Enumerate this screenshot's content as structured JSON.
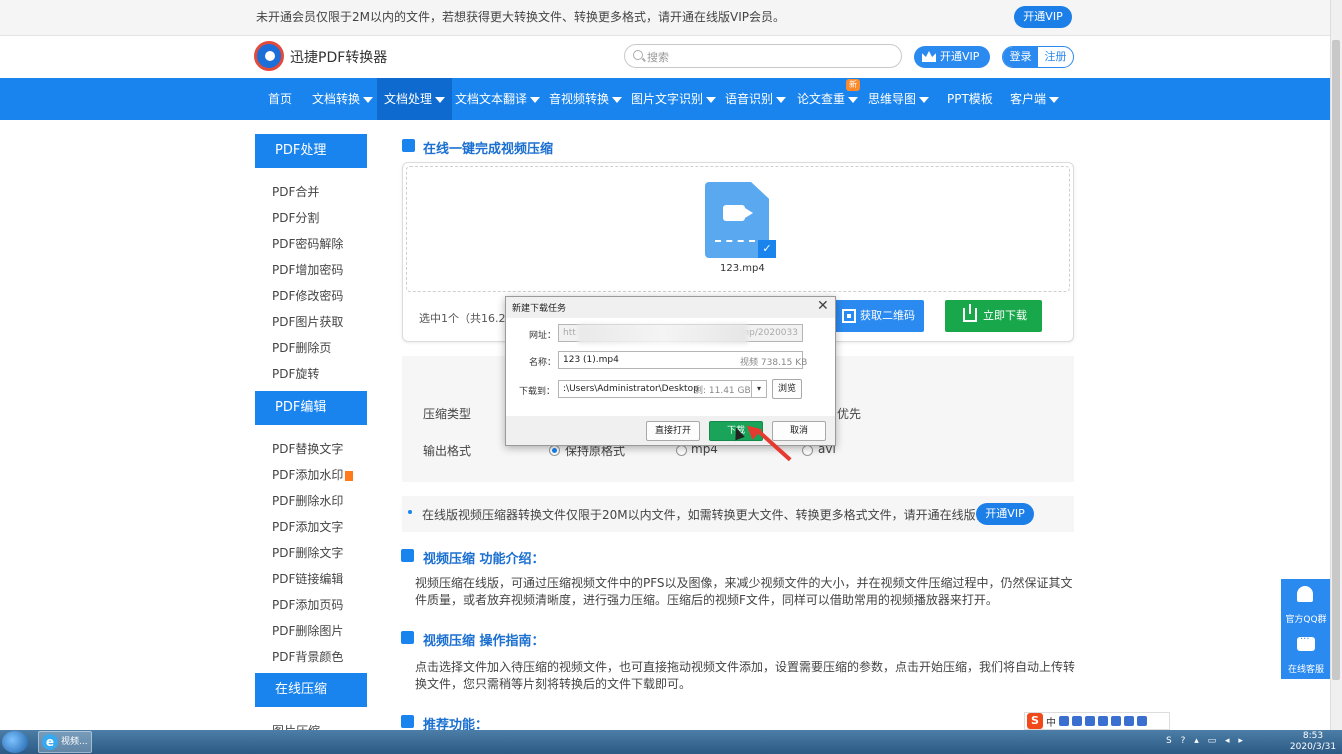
{
  "promo": {
    "text": "未开通会员仅限于2M以内的文件，若想获得更大转换文件、转换更多格式，请开通在线版VIP会员。",
    "button": "开通VIP"
  },
  "header": {
    "logo_text": "迅捷PDF转换器",
    "search_placeholder": "搜索",
    "vip_button": "开通VIP",
    "login": "登录",
    "register": "注册"
  },
  "nav": {
    "items": [
      {
        "label": "首页"
      },
      {
        "label": "文档转换"
      },
      {
        "label": "文档处理"
      },
      {
        "label": "文档文本翻译"
      },
      {
        "label": "音视频转换"
      },
      {
        "label": "图片文字识别"
      },
      {
        "label": "语音识别"
      },
      {
        "label": "论文查重"
      },
      {
        "label": "思维导图"
      },
      {
        "label": "PPT模板"
      },
      {
        "label": "客户端"
      }
    ],
    "new_badge": "新"
  },
  "sidebar": {
    "sections": [
      {
        "title": "PDF处理",
        "items": [
          "PDF合并",
          "PDF分割",
          "PDF密码解除",
          "PDF增加密码",
          "PDF修改密码",
          "PDF图片获取",
          "PDF删除页",
          "PDF旋转"
        ]
      },
      {
        "title": "PDF编辑",
        "items": [
          "PDF替换文字",
          "PDF添加水印",
          "PDF删除水印",
          "PDF添加文字",
          "PDF删除文字",
          "PDF链接编辑",
          "PDF添加页码",
          "PDF删除图片",
          "PDF背景颜色"
        ]
      },
      {
        "title": "在线压缩",
        "items": [
          "图片压缩"
        ]
      }
    ]
  },
  "main": {
    "title": "在线一键完成视频压缩",
    "file_name": "123.mp4",
    "selected": "选中1个（共16.22M",
    "qr_button": "获取二维码",
    "download_button": "立即下载",
    "compress_type_label": "压缩类型",
    "compress_option_right": "优先",
    "output_format_label": "输出格式",
    "formats": [
      "保持原格式",
      "mp4",
      "avi"
    ],
    "notice": "在线版视频压缩器转换文件仅限于20M以内文件，如需转换更大文件、转换更多格式文件，请开通在线版会员。",
    "notice_button": "开通VIP",
    "intro_title": "视频压缩 功能介绍：",
    "intro_text": "视频压缩在线版，可通过压缩视频文件中的PFS以及图像，来减少视频文件的大小，并在视频文件压缩过程中，仍然保证其文件质量，或者放弃视频清晰度，进行强力压缩。压缩后的视频F文件，同样可以借助常用的视频播放器来打开。",
    "guide_title": "视频压缩 操作指南：",
    "guide_text": "点击选择文件加入待压缩的视频文件，也可直接拖动视频文件添加，设置需要压缩的参数，点击开始压缩，我们将自动上传转换文件，您只需稍等片刻将转换后的文件下载即可。",
    "recommend_title": "推荐功能："
  },
  "dialog": {
    "title": "新建下载任务",
    "url_label": "网址：",
    "url_start": "htt",
    "url_end": "mp/2020033",
    "name_label": "名称：",
    "name_value": "123 (1).mp4",
    "name_meta": "视频 738.15 KB",
    "path_label": "下载到：",
    "path_value": ":\\Users\\Administrator\\Desktop",
    "path_meta": "剩: 11.41 GB",
    "browse": "浏览",
    "open_direct": "直接打开",
    "download": "下载",
    "cancel": "取消"
  },
  "float_panel": {
    "qq_group": "官方QQ群",
    "online_service": "在线客服"
  },
  "ime": {
    "mode": "中"
  },
  "taskbar": {
    "ie_label": "视频...",
    "time": "8:53",
    "date": "2020/3/31"
  },
  "colors": {
    "brand_blue": "#1a84ee",
    "download_green": "#18a74a",
    "arrow_red": "#e53a2f"
  }
}
